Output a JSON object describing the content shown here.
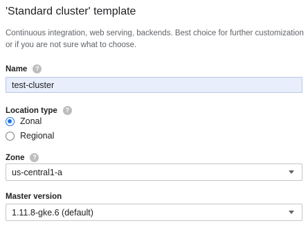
{
  "header": {
    "title": "'Standard cluster' template",
    "description": "Continuous integration, web serving, backends. Best choice for further customization or if you are not sure what to choose."
  },
  "name_field": {
    "label": "Name",
    "help_icon": "help-icon",
    "value": "test-cluster"
  },
  "location_type": {
    "label": "Location type",
    "help_icon": "help-icon",
    "options": [
      {
        "label": "Zonal",
        "checked": true
      },
      {
        "label": "Regional",
        "checked": false
      }
    ]
  },
  "zone": {
    "label": "Zone",
    "help_icon": "help-icon",
    "value": "us-central1-a"
  },
  "master_version": {
    "label": "Master version",
    "value": "1.11.8-gke.6 (default)"
  },
  "colors": {
    "accent": "#1a73e8",
    "input_fill": "#e8eefb"
  }
}
